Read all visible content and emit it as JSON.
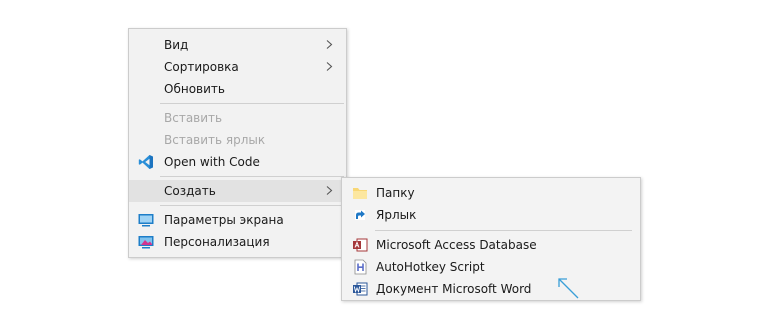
{
  "context_menu": {
    "items": [
      {
        "label": "Вид",
        "has_submenu": true
      },
      {
        "label": "Сортировка",
        "has_submenu": true
      },
      {
        "label": "Обновить"
      },
      {
        "label": "Вставить",
        "disabled": true
      },
      {
        "label": "Вставить ярлык",
        "disabled": true
      },
      {
        "label": "Open with Code",
        "icon": "vscode-icon"
      },
      {
        "label": "Создать",
        "has_submenu": true
      },
      {
        "label": "Параметры экрана",
        "icon": "display-settings-icon"
      },
      {
        "label": "Персонализация",
        "icon": "personalization-icon"
      }
    ]
  },
  "new_submenu": {
    "items": [
      {
        "label": "Папку",
        "icon": "folder-icon"
      },
      {
        "label": "Ярлык",
        "icon": "shortcut-icon"
      },
      {
        "label": "Microsoft Access Database",
        "icon": "access-icon"
      },
      {
        "label": "AutoHotkey Script",
        "icon": "autohotkey-icon"
      },
      {
        "label": "Документ Microsoft Word",
        "icon": "word-icon"
      }
    ]
  },
  "colors": {
    "menu_bg": "#f2f2f2",
    "hover_bg": "#e2e2e2",
    "disabled_text": "#a8a8a8",
    "accent_arrow": "#3a9fd8"
  }
}
